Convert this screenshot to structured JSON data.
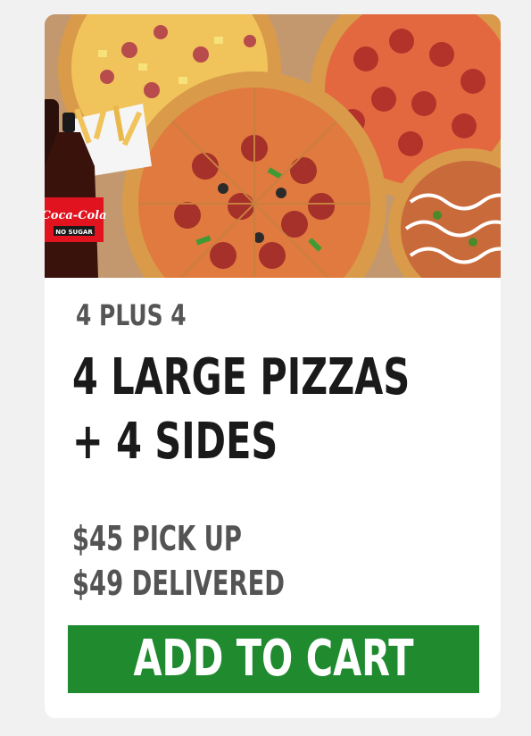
{
  "offer": {
    "eyebrow": "4 PLUS 4",
    "headline_line1": "4 LARGE PIZZAS",
    "headline_line2": "+ 4 SIDES",
    "price_pickup": "$45 PICK UP",
    "price_delivered": "$49 DELIVERED",
    "cta_label": "ADD TO CART"
  },
  "hero": {
    "bottle_brand": "Coca-Cola",
    "bottle_variant": "NO SUGAR"
  },
  "colors": {
    "cta_background": "#1f8a2e",
    "cta_text": "#ffffff",
    "headline": "#1a1a1a",
    "subtext": "#555555",
    "card": "#ffffff",
    "page": "#f1f1f1"
  }
}
